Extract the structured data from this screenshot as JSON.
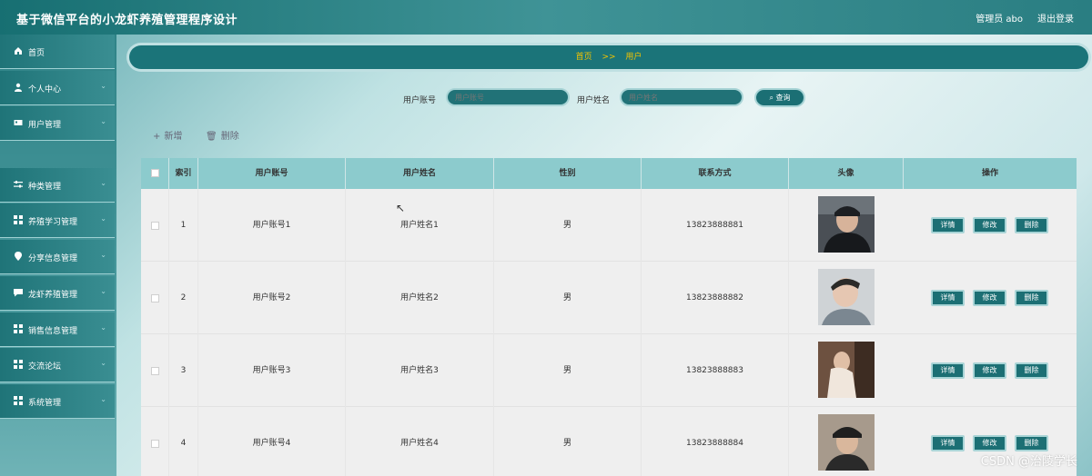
{
  "header": {
    "title": "基于微信平台的小龙虾养殖管理程序设计",
    "user": "管理员 abo",
    "logout": "退出登录"
  },
  "sidebar": {
    "items": [
      {
        "label": "首页",
        "icon": "home-icon"
      },
      {
        "label": "个人中心",
        "icon": "person-icon"
      },
      {
        "label": "用户管理",
        "icon": "card-icon"
      },
      {
        "label": "种类管理",
        "icon": "sliders-icon"
      },
      {
        "label": "养殖学习管理",
        "icon": "grid-icon"
      },
      {
        "label": "分享信息管理",
        "icon": "pin-icon"
      },
      {
        "label": "龙虾养殖管理",
        "icon": "chat-icon"
      },
      {
        "label": "销售信息管理",
        "icon": "grid-icon"
      },
      {
        "label": "交流论坛",
        "icon": "grid-icon"
      },
      {
        "label": "系统管理",
        "icon": "grid-icon"
      }
    ]
  },
  "breadcrumb": {
    "home": "首页",
    "sep": ">>",
    "current": "用户"
  },
  "search": {
    "account_label": "用户账号",
    "account_placeholder": "用户账号",
    "name_label": "用户姓名",
    "name_placeholder": "用户姓名",
    "button": "查询"
  },
  "actions": {
    "add": "新增",
    "delete": "删除"
  },
  "table": {
    "headers": [
      "索引",
      "用户账号",
      "用户姓名",
      "性别",
      "联系方式",
      "头像",
      "操作"
    ],
    "rows": [
      {
        "index": "1",
        "account": "用户账号1",
        "name": "用户姓名1",
        "gender": "男",
        "phone": "13823888881"
      },
      {
        "index": "2",
        "account": "用户账号2",
        "name": "用户姓名2",
        "gender": "男",
        "phone": "13823888882"
      },
      {
        "index": "3",
        "account": "用户账号3",
        "name": "用户姓名3",
        "gender": "男",
        "phone": "13823888883"
      },
      {
        "index": "4",
        "account": "用户账号4",
        "name": "用户姓名4",
        "gender": "男",
        "phone": "13823888884"
      }
    ],
    "ops": {
      "detail": "详情",
      "edit": "修改",
      "remove": "删除"
    }
  },
  "watermark": "CSDN @治陵学长",
  "colors": {
    "primary": "#1b7479",
    "breadcrumb_text": "#f3c300",
    "header_row": "#8ccbcd"
  }
}
